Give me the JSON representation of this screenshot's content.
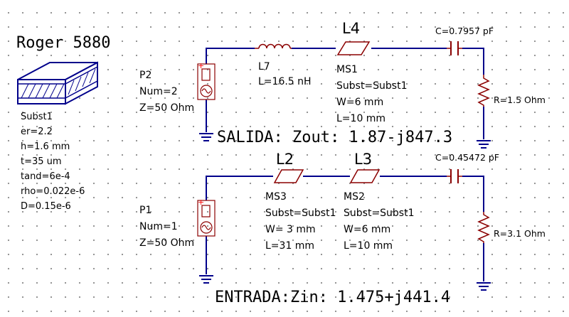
{
  "substrate": {
    "title": "Roger 5880",
    "name": "Subst1",
    "params": [
      "er=2.2",
      "h=1.6 mm",
      "t=35 um",
      "tand=6e-4",
      "rho=0.022e-6",
      "D=0.15e-6"
    ]
  },
  "output_port": {
    "name": "P2",
    "num": "Num=2",
    "z": "Z=50 Ohm"
  },
  "input_port": {
    "name": "P1",
    "num": "Num=1",
    "z": "Z=50 Ohm"
  },
  "inductor": {
    "name": "L7",
    "value": "L=16.5 nH"
  },
  "l4": {
    "title": "L4",
    "name": "MS1",
    "subst": "Subst=Subst1",
    "w": "W=6 mm",
    "l": "L=10 mm"
  },
  "l2": {
    "title": "L2",
    "name": "MS3",
    "subst": "Subst=Subst1",
    "w": "W= 3 mm",
    "l": "L=31 mm"
  },
  "l3": {
    "title": "L3",
    "name": "MS2",
    "subst": "Subst=Subst1",
    "w": "W=6 mm",
    "l": "L=10 mm"
  },
  "cap_top": {
    "value": "C=0.7957 pF"
  },
  "cap_bottom": {
    "value": "C=0.45472 pF"
  },
  "res_top": {
    "value": "R=1.5 Ohm"
  },
  "res_bottom": {
    "value": "R=3.1 Ohm"
  },
  "output_text": "SALIDA: Zout: 1.87-j847.3",
  "input_text": "ENTRADA:Zin: 1.475+j441.4",
  "colors": {
    "wire": "#00008b",
    "component": "#8b0000",
    "port_plus": "#ff0000"
  }
}
